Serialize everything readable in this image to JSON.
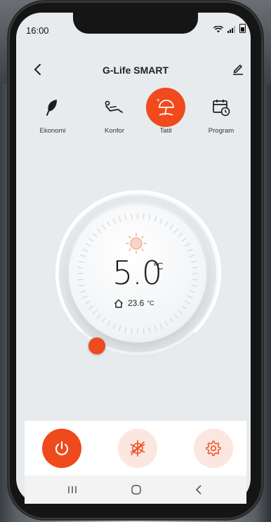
{
  "status_bar": {
    "time": "16:00"
  },
  "header": {
    "title": "G-Life SMART"
  },
  "modes": [
    {
      "label": "Ekonomi",
      "icon": "leaf-icon"
    },
    {
      "label": "Konfor",
      "icon": "recliner-icon"
    },
    {
      "label": "Tatil",
      "icon": "beach-umbrella-icon",
      "active": true
    },
    {
      "label": "Program",
      "icon": "calendar-clock-icon"
    }
  ],
  "thermostat": {
    "setpoint": "5.0",
    "setpoint_unit": "℃",
    "ambient_temp": "23.6",
    "ambient_unit": "°C"
  },
  "colors": {
    "accent": "#ee4a1c",
    "accent_light": "#fbe6e0",
    "background": "#e7ebee"
  }
}
